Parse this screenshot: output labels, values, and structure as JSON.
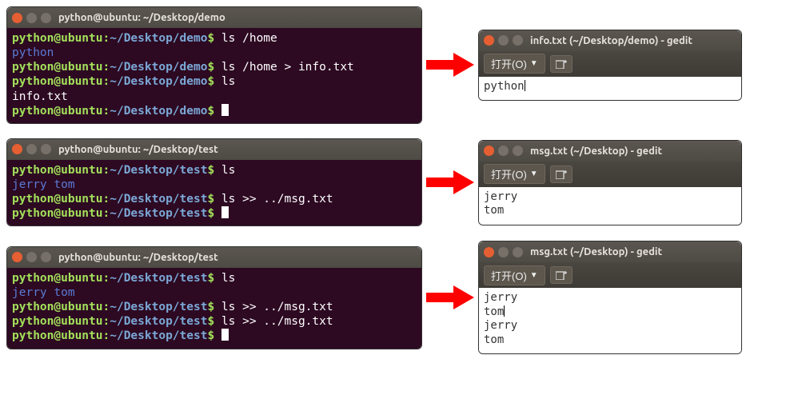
{
  "rows": [
    {
      "terminal": {
        "title": "python@ubuntu: ~/Desktop/demo",
        "prompt_user": "python@ubuntu",
        "prompt_sep": ":",
        "prompt_path": "~/Desktop/demo",
        "prompt_dollar": "$",
        "lines": [
          {
            "type": "prompt",
            "cmd": "ls /home"
          },
          {
            "type": "out-blue",
            "text": "python"
          },
          {
            "type": "prompt",
            "cmd": "ls /home > info.txt"
          },
          {
            "type": "prompt",
            "cmd": "ls"
          },
          {
            "type": "out-white",
            "text": "info.txt"
          },
          {
            "type": "prompt",
            "cmd": "",
            "cursor": true
          }
        ]
      },
      "gedit": {
        "title": "info.txt (~/Desktop/demo) - gedit",
        "open_label": "打开(O)",
        "content": [
          "python"
        ],
        "cursor_line": 0
      }
    },
    {
      "terminal": {
        "title": "python@ubuntu: ~/Desktop/test",
        "prompt_user": "python@ubuntu",
        "prompt_sep": ":",
        "prompt_path": "~/Desktop/test",
        "prompt_dollar": "$",
        "lines": [
          {
            "type": "prompt",
            "cmd": "ls"
          },
          {
            "type": "out-blue",
            "text": "jerry  tom"
          },
          {
            "type": "prompt",
            "cmd": "ls >> ../msg.txt"
          },
          {
            "type": "prompt",
            "cmd": "",
            "cursor": true
          }
        ]
      },
      "gedit": {
        "title": "msg.txt (~/Desktop) - gedit",
        "open_label": "打开(O)",
        "content": [
          "jerry",
          "tom"
        ],
        "cursor_line": -1
      }
    },
    {
      "terminal": {
        "title": "python@ubuntu: ~/Desktop/test",
        "prompt_user": "python@ubuntu",
        "prompt_sep": ":",
        "prompt_path": "~/Desktop/test",
        "prompt_dollar": "$",
        "lines": [
          {
            "type": "prompt",
            "cmd": "ls"
          },
          {
            "type": "out-blue",
            "text": "jerry  tom"
          },
          {
            "type": "prompt",
            "cmd": "ls >> ../msg.txt"
          },
          {
            "type": "prompt",
            "cmd": "ls >> ../msg.txt"
          },
          {
            "type": "prompt",
            "cmd": "",
            "cursor": true
          }
        ]
      },
      "gedit": {
        "title": "msg.txt (~/Desktop) - gedit",
        "open_label": "打开(O)",
        "content": [
          "jerry",
          "tom",
          "jerry",
          "tom"
        ],
        "cursor_line": 1
      }
    }
  ]
}
